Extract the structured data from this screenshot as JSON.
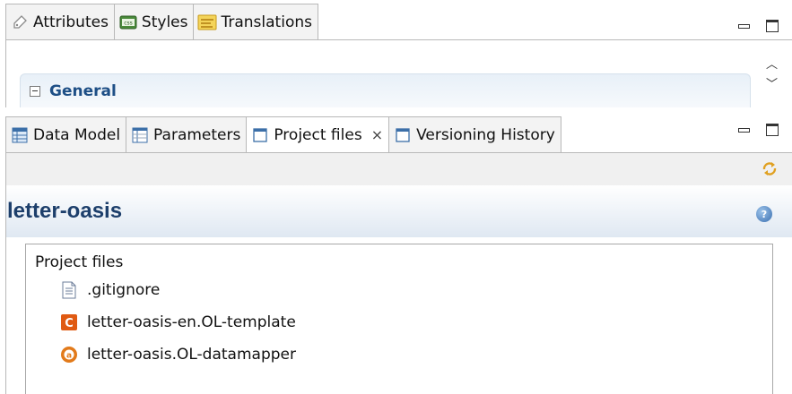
{
  "top_panel": {
    "tabs": [
      {
        "label": "Attributes",
        "icon": "attribute-tag-icon"
      },
      {
        "label": "Styles",
        "icon": "css-styles-icon"
      },
      {
        "label": "Translations",
        "icon": "translations-icon"
      }
    ],
    "section": {
      "title": "General"
    }
  },
  "bottom_panel": {
    "tabs": [
      {
        "label": "Data Model",
        "icon": "data-model-icon"
      },
      {
        "label": "Parameters",
        "icon": "parameters-icon"
      },
      {
        "label": "Project files",
        "icon": "project-files-icon",
        "active": true,
        "close": "×"
      },
      {
        "label": "Versioning History",
        "icon": "versioning-history-icon"
      }
    ],
    "project_name": "letter-oasis",
    "help": "?",
    "files_section": {
      "title": "Project files",
      "items": [
        {
          "name": ".gitignore",
          "icon": "text-file-icon"
        },
        {
          "name": "letter-oasis-en.OL-template",
          "icon": "template-file-icon"
        },
        {
          "name": "letter-oasis.OL-datamapper",
          "icon": "datamapper-file-icon"
        }
      ]
    }
  },
  "colors": {
    "title_blue": "#1d3f6b",
    "section_blue": "#1e4f86",
    "template_orange": "#e05a12"
  }
}
